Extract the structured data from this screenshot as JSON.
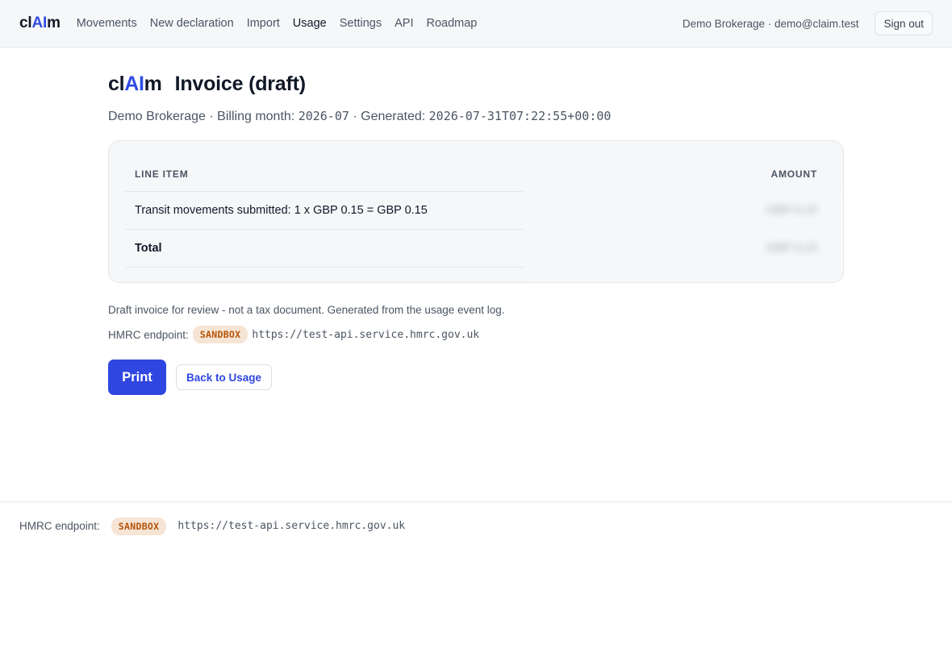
{
  "nav": {
    "logo_prefix": "cl",
    "logo_ai": "AI",
    "logo_suffix": "m",
    "links": [
      {
        "label": "Movements"
      },
      {
        "label": "New declaration"
      },
      {
        "label": "Import"
      },
      {
        "label": "Usage",
        "active": true
      },
      {
        "label": "Settings"
      },
      {
        "label": "API"
      },
      {
        "label": "Roadmap"
      }
    ],
    "account": "Demo Brokerage · demo@claim.test",
    "signout_label": "Sign out"
  },
  "page": {
    "logo_prefix": "cl",
    "logo_ai": "AI",
    "logo_suffix": "m",
    "title": "Invoice (draft)",
    "org": "Demo Brokerage",
    "billing_label": "· Billing month:",
    "billing_month": "2026-07",
    "generated_label": "· Generated:",
    "generated": "2026-07-31T07:22:55+00:00"
  },
  "table": {
    "col_item": "LINE ITEM",
    "col_amount": "AMOUNT",
    "rows": [
      {
        "item": "Transit movements submitted: 1 x GBP 0.15 = GBP 0.15",
        "amount": "GBP 0.15"
      }
    ],
    "total_label": "Total",
    "total_amount": "GBP 0.15"
  },
  "note": "Draft invoice for review - not a tax document. Generated from the usage event log.",
  "endpoint": {
    "label": "HMRC endpoint:",
    "badge": "SANDBOX",
    "url": "https://test-api.service.hmrc.gov.uk"
  },
  "actions": {
    "print_label": "Print",
    "back_label": "Back to Usage"
  },
  "footer": {
    "label": "HMRC endpoint:",
    "badge": "SANDBOX",
    "url": "https://test-api.service.hmrc.gov.uk"
  },
  "colors": {
    "accent": "#2f46e0",
    "badge_bg": "#f6e4d4",
    "badge_text": "#b45309"
  }
}
